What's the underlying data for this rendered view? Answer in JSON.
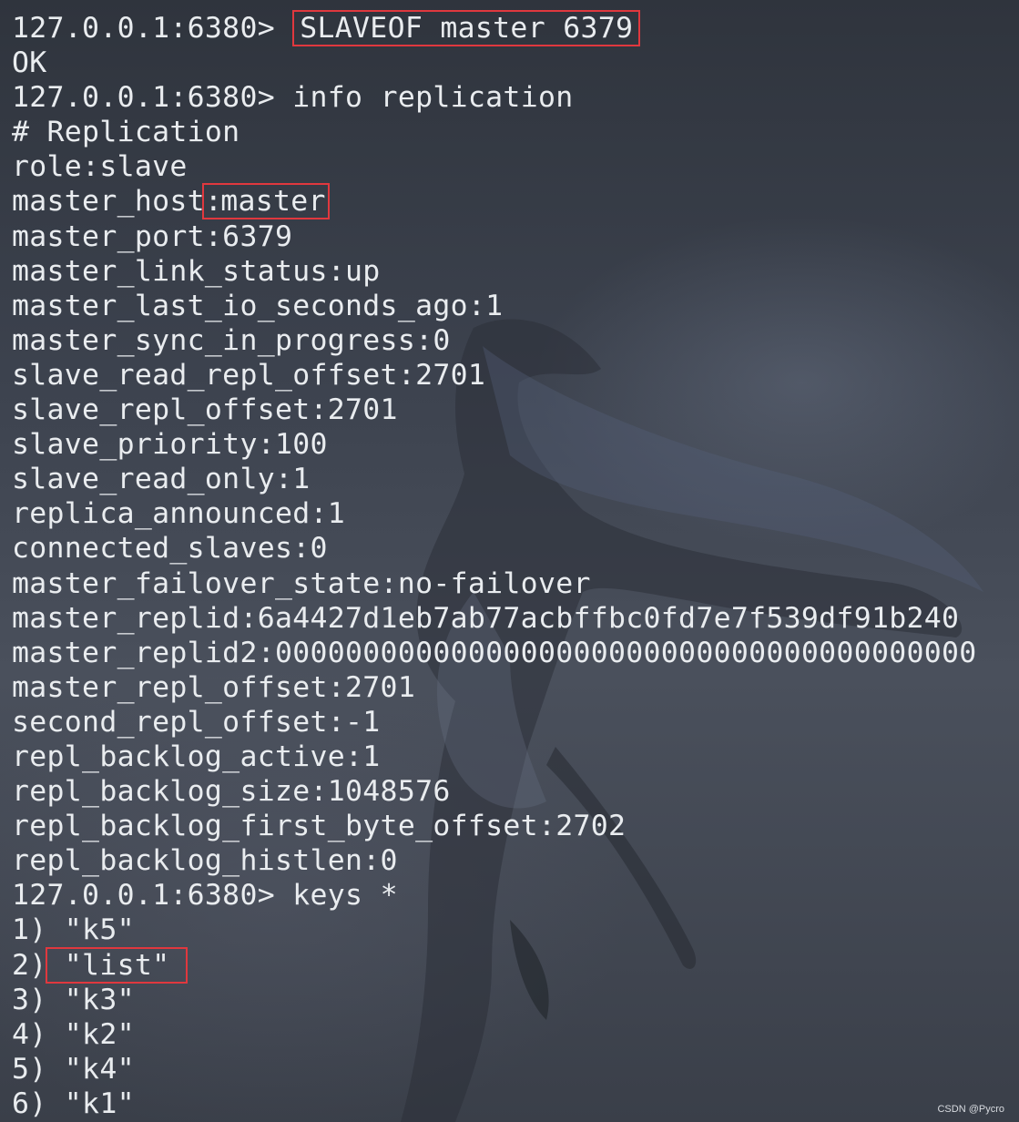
{
  "prompt": "127.0.0.1:6380>",
  "lines": {
    "cmd1": "SLAVEOF master 6379",
    "ok": "OK",
    "cmd2": "info replication",
    "header": "# Replication",
    "role": "role:slave",
    "master_host_key": "master_host:",
    "master_host_val": "master",
    "master_port": "master_port:6379",
    "master_link_status": "master_link_status:up",
    "master_last_io": "master_last_io_seconds_ago:1",
    "master_sync": "master_sync_in_progress:0",
    "slave_read_repl_offset": "slave_read_repl_offset:2701",
    "slave_repl_offset": "slave_repl_offset:2701",
    "slave_priority": "slave_priority:100",
    "slave_read_only": "slave_read_only:1",
    "replica_announced": "replica_announced:1",
    "connected_slaves": "connected_slaves:0",
    "master_failover_state": "master_failover_state:no-failover",
    "master_replid": "master_replid:6a4427d1eb7ab77acbffbc0fd7e7f539df91b240",
    "master_replid2": "master_replid2:0000000000000000000000000000000000000000",
    "master_repl_offset": "master_repl_offset:2701",
    "second_repl_offset": "second_repl_offset:-1",
    "repl_backlog_active": "repl_backlog_active:1",
    "repl_backlog_size": "repl_backlog_size:1048576",
    "repl_backlog_first": "repl_backlog_first_byte_offset:2702",
    "repl_backlog_histlen": "repl_backlog_histlen:0",
    "cmd3": "keys *",
    "keys": [
      {
        "idx": "1)",
        "val": "\"k5\""
      },
      {
        "idx": "2)",
        "val": "\"list\""
      },
      {
        "idx": "3)",
        "val": "\"k3\""
      },
      {
        "idx": "4)",
        "val": "\"k2\""
      },
      {
        "idx": "5)",
        "val": "\"k4\""
      },
      {
        "idx": "6)",
        "val": "\"k1\""
      }
    ]
  },
  "watermark": "CSDN @Pycro",
  "colors": {
    "text": "#e9ecef",
    "highlight_box": "#e0383e"
  }
}
